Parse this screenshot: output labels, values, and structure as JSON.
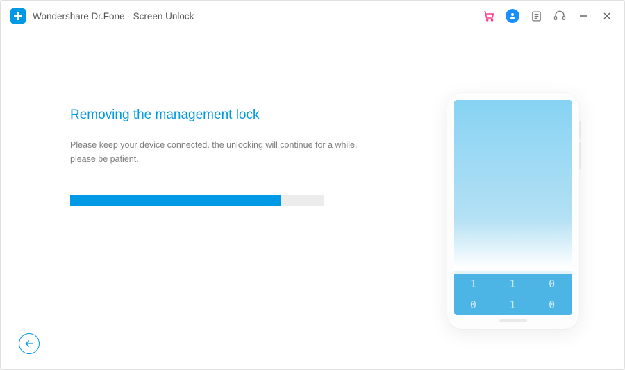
{
  "header": {
    "title": "Wondershare Dr.Fone - Screen Unlock"
  },
  "main": {
    "heading": "Removing the management lock",
    "subtext_line1": "Please keep your device connected. the unlocking will continue for a while.",
    "subtext_line2": "please be patient.",
    "progress_percent": 83
  },
  "keypad": {
    "r1c1": "1",
    "r1c2": "1",
    "r1c3": "0",
    "r2c1": "0",
    "r2c2": "1",
    "r2c3": "0"
  },
  "colors": {
    "accent": "#0099e5"
  }
}
